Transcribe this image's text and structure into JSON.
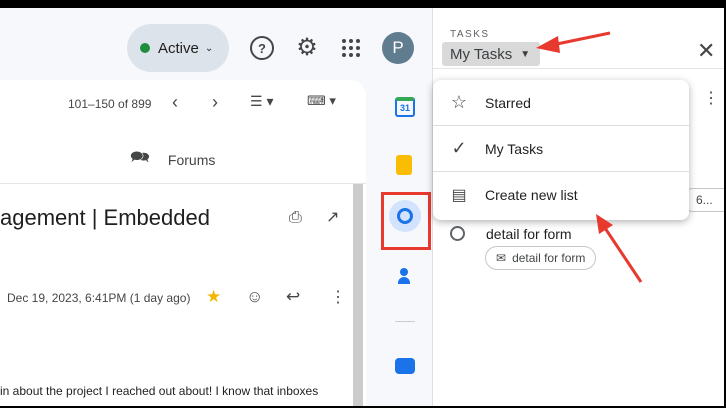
{
  "topbar": {
    "status_label": "Active",
    "avatar_letter": "P"
  },
  "toolbar": {
    "pagination": "101–150 of 899"
  },
  "tabs": {
    "forums": "Forums"
  },
  "email": {
    "subject": "agement | Embedded",
    "date": "Dec 19, 2023, 6:41PM (1 day ago)",
    "body_line1": "in about the project I reached out about! I know that inboxes",
    "body_line2": "... ... ... ..."
  },
  "rail": {
    "calendar_day": "31"
  },
  "tasks": {
    "header": "TASKS",
    "list_name": "My Tasks",
    "task_title": "detail for form",
    "task_chip": "detail for form",
    "partial_chip": "6..."
  },
  "menu": {
    "items": [
      {
        "label": "Starred"
      },
      {
        "label": "My Tasks"
      },
      {
        "label": "Create new list"
      }
    ]
  },
  "colors": {
    "annotation": "#e8392f",
    "active_dot": "#1e8e3e",
    "star": "#f4b400",
    "tasks_blue": "#1a73e8"
  }
}
